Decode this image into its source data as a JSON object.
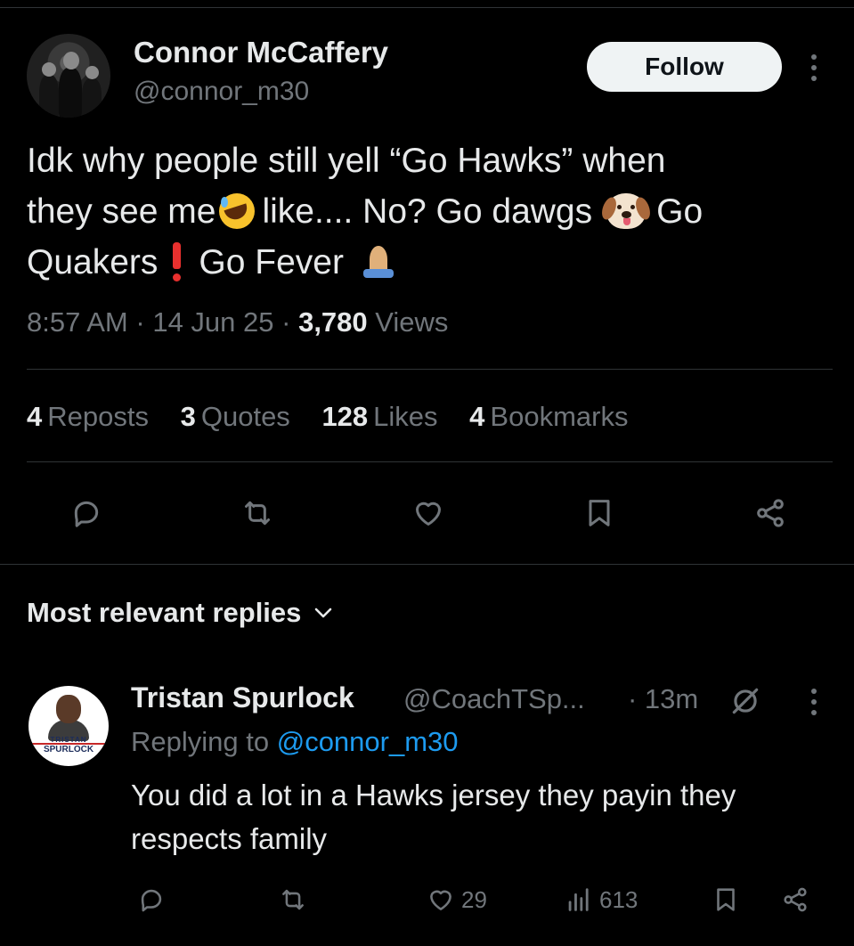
{
  "tweet": {
    "author_name": "Connor McCaffery",
    "author_handle": "@connor_m30",
    "follow_label": "Follow",
    "text_line1": "Idk why people still yell “Go Hawks” when",
    "text_line2a": "they see me",
    "text_line2b": "like.... No? Go dawgs",
    "text_line2c": "Go",
    "text_line3a": "Quakers",
    "text_line3b": "Go Fever",
    "time": "8:57 AM",
    "date": "14 Jun 25",
    "views_count": "3,780",
    "views_label": "Views",
    "sep": "·"
  },
  "stats": [
    {
      "num": "4",
      "label": "Reposts"
    },
    {
      "num": "3",
      "label": "Quotes"
    },
    {
      "num": "128",
      "label": "Likes"
    },
    {
      "num": "4",
      "label": "Bookmarks"
    }
  ],
  "replies_header": "Most relevant replies",
  "reply": {
    "name": "Tristan Spurlock",
    "handle": "@CoachTSp...",
    "time": "· 13m",
    "replying_prefix": "Replying to",
    "replying_to": "@connor_m30",
    "text": "You did a lot in a Hawks jersey they payin they respects family",
    "likes": "29",
    "views": "613",
    "avatar_line1": "TRISTAN",
    "avatar_line2": "SPURLOCK"
  },
  "colors": {
    "background": "#000000",
    "text": "#e7e9ea",
    "secondary": "#71767b",
    "accent": "#1d9bf0",
    "divider": "#2f3336"
  }
}
